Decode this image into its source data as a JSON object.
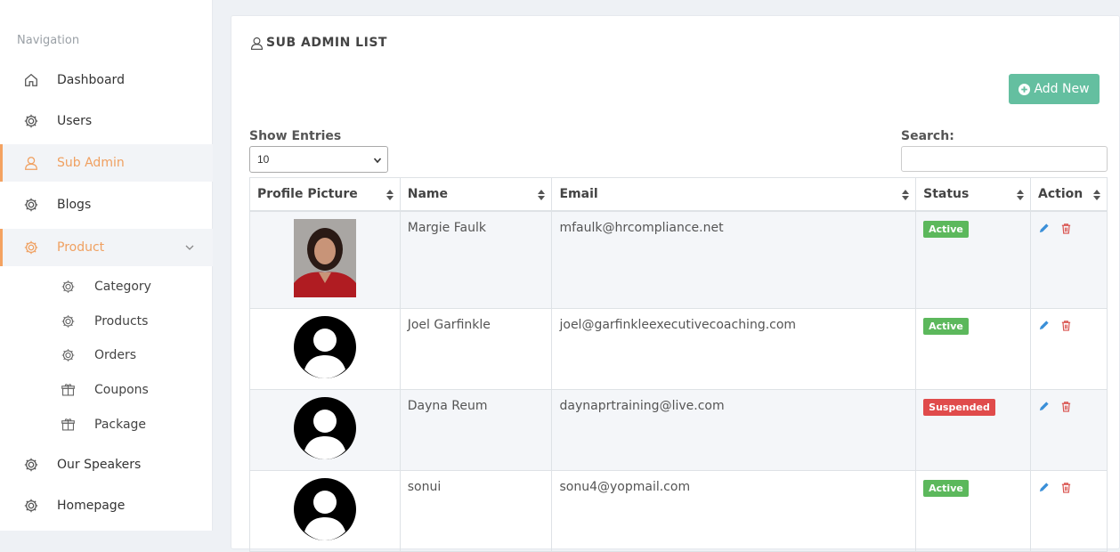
{
  "sidebar": {
    "heading": "Navigation",
    "items": [
      {
        "label": "Dashboard",
        "icon": "home-icon"
      },
      {
        "label": "Users",
        "icon": "gear-icon"
      },
      {
        "label": "Sub Admin",
        "icon": "user-icon",
        "active": true
      },
      {
        "label": "Blogs",
        "icon": "gear-icon"
      },
      {
        "label": "Product",
        "icon": "gear-icon",
        "expanded": true
      },
      {
        "label": "Our Speakers",
        "icon": "gear-icon"
      },
      {
        "label": "Homepage",
        "icon": "gear-icon"
      }
    ],
    "product_children": [
      {
        "label": "Category",
        "icon": "gear-icon"
      },
      {
        "label": "Products",
        "icon": "gear-icon"
      },
      {
        "label": "Orders",
        "icon": "gear-icon"
      },
      {
        "label": "Coupons",
        "icon": "gift-icon"
      },
      {
        "label": "Package",
        "icon": "gift-icon"
      }
    ]
  },
  "page": {
    "title": "SUB ADMIN LIST",
    "add_button": "Add New",
    "show_entries_label": "Show Entries",
    "show_entries_value": "10",
    "search_label": "Search:",
    "search_value": ""
  },
  "table": {
    "columns": [
      "Profile Picture",
      "Name",
      "Email",
      "Status",
      "Action"
    ],
    "rows": [
      {
        "name": "Margie Faulk",
        "email": "mfaulk@hrcompliance.net",
        "status": "Active",
        "picture": "photo"
      },
      {
        "name": "Joel Garfinkle",
        "email": "joel@garfinkleexecutivecoaching.com",
        "status": "Active",
        "picture": "default-avatar"
      },
      {
        "name": "Dayna Reum",
        "email": "daynaprtraining@live.com",
        "status": "Suspended",
        "picture": "default-avatar"
      },
      {
        "name": "sonui",
        "email": "sonu4@yopmail.com",
        "status": "Active",
        "picture": "default-avatar"
      }
    ]
  },
  "colors": {
    "accent": "#f0a060",
    "add_button": "#64bfa0",
    "active_badge": "#5cb85c",
    "suspended_badge": "#e04b4b",
    "edit_icon": "#3a8fd8",
    "delete_icon": "#d9534f"
  }
}
